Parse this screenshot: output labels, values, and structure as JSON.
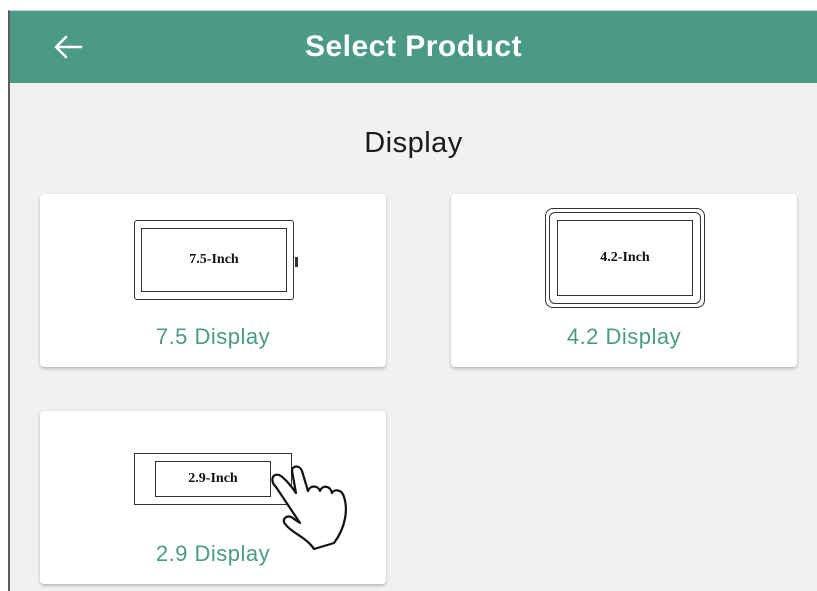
{
  "app_bar": {
    "title": "Select Product",
    "back_icon": "arrow-left-icon",
    "background_color": "#4a9a85"
  },
  "section": {
    "title": "Display"
  },
  "products": [
    {
      "device_label": "7.5-Inch",
      "name": "7.5 Display"
    },
    {
      "device_label": "4.2-Inch",
      "name": "4.2 Display"
    },
    {
      "device_label": "2.9-Inch",
      "name": "2.9 Display"
    }
  ],
  "overlay_icon": "pointing-hand-icon",
  "accent_color": "#4a9a85"
}
